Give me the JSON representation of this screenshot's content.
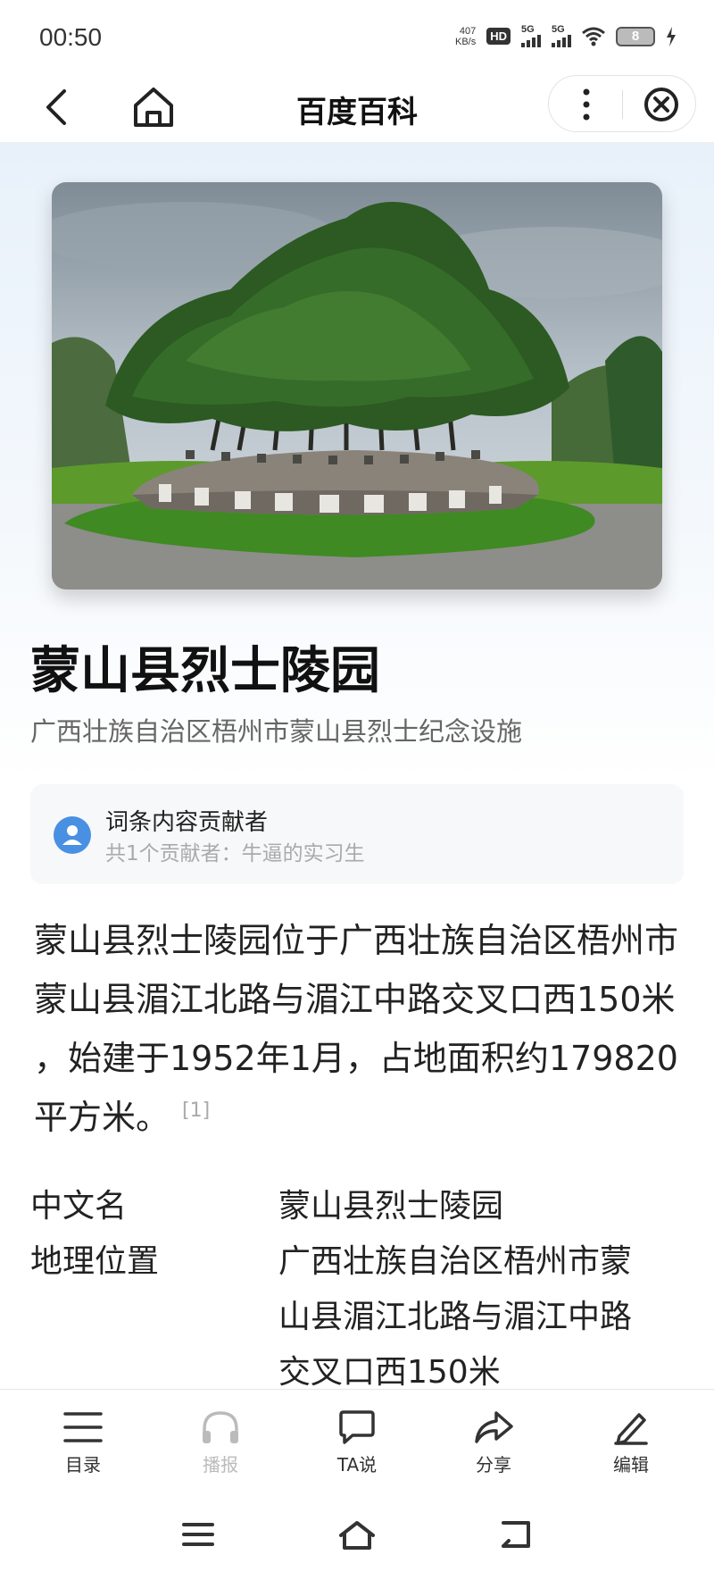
{
  "status_bar": {
    "time": "00:50",
    "net_speed_value": "407",
    "net_speed_unit": "KB/s",
    "hd_label": "HD",
    "signal1_label": "5G",
    "signal2_label": "5G",
    "battery_level": "8"
  },
  "nav": {
    "title": "百度百科"
  },
  "entry": {
    "title": "蒙山县烈士陵园",
    "subtitle": "广西壮族自治区梧州市蒙山县烈士纪念设施"
  },
  "contributors": {
    "title": "词条内容贡献者",
    "summary": "共1个贡献者：牛逼的实习生"
  },
  "summary": {
    "text": "蒙山县烈士陵园位于广西壮族自治区梧州市蒙山县湄江北路与湄江中路交叉口西150米 ，始建于1952年1月，占地面积约179820平方米。",
    "reference": "[1]"
  },
  "info_table": [
    {
      "key": "中文名",
      "value": "蒙山县烈士陵园"
    },
    {
      "key": "地理位置",
      "value": "广西壮族自治区梧州市蒙山县湄江北路与湄江中路交叉口西150米"
    }
  ],
  "toolbar": {
    "catalog": "目录",
    "broadcast": "播报",
    "ta_say": "TA说",
    "share": "分享",
    "edit": "编辑"
  },
  "colors": {
    "accent_blue": "#4a90e2",
    "muted_text": "#aaaaaa"
  }
}
